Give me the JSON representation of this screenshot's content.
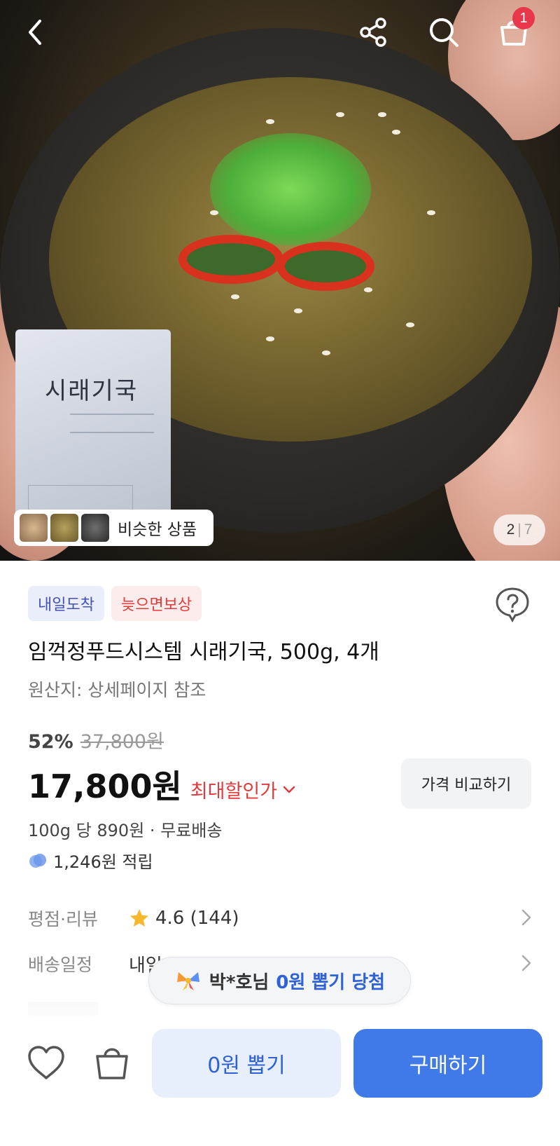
{
  "topbar": {
    "back_icon": "chevron-left-icon",
    "share_icon": "share-icon",
    "search_icon": "search-icon",
    "cart_icon": "cart-icon",
    "cart_badge": "1",
    "badge_color": "#e8374a"
  },
  "hero": {
    "package_text": "시래기국",
    "similar_label": "비슷한 상품",
    "image_index": "2",
    "image_total": "7"
  },
  "badges": [
    {
      "label": "내일도착"
    },
    {
      "label": "늦으면보상"
    }
  ],
  "product": {
    "title": "임꺽정푸드시스템 시래기국, 500g, 4개",
    "origin": "원산지: 상세페이지 참조",
    "discount_rate": "52%",
    "original_price": "37,800원",
    "price": "17,800원",
    "max_discount_label": "최대할인가",
    "compare_button": "가격 비교하기",
    "unit_price": "100g 당 890원 · 무료배송",
    "points": "1,246원 적립"
  },
  "info_rows": {
    "rating_label": "평점·리뷰",
    "rating_value": "4.6 (144)",
    "shipping_label": "배송일정",
    "shipping_value": "내일"
  },
  "toast": {
    "name": "박*호님",
    "highlight": "0원 뽑기 당첨"
  },
  "bottom": {
    "draw_button": "0원 뽑기",
    "buy_button": "구매하기"
  },
  "colors": {
    "accent_blue": "#3f7ae8",
    "sale_red": "#e23b3b",
    "star_yellow": "#f5b82e"
  }
}
